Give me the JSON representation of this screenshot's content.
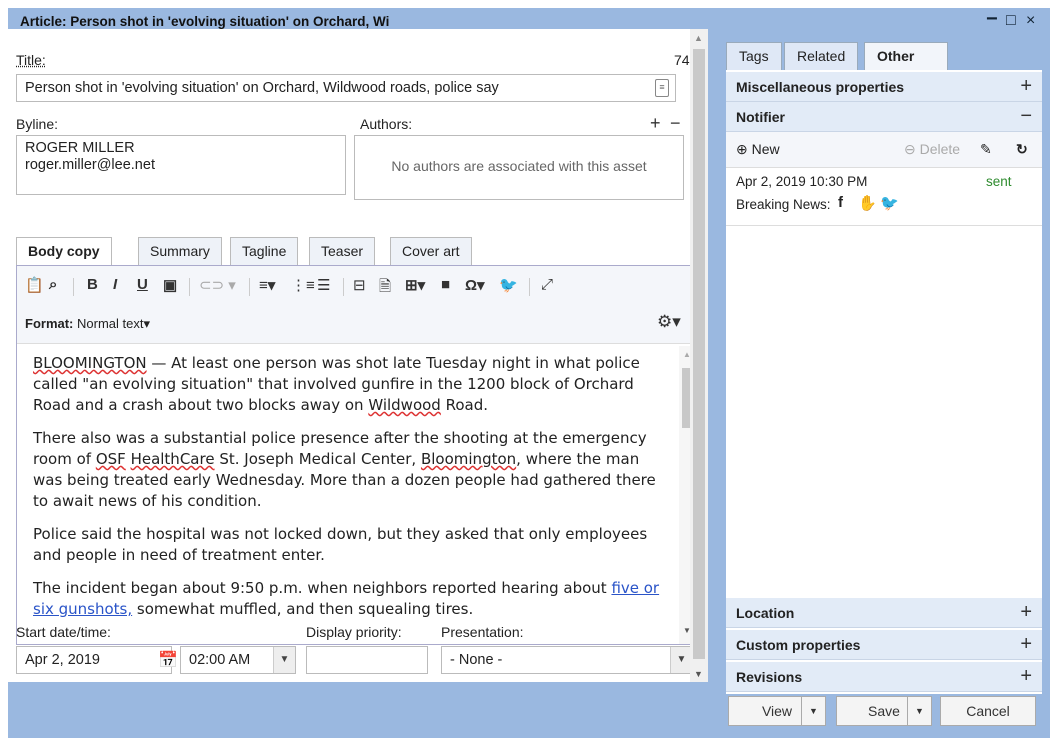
{
  "window": {
    "title": "Article: Person shot in 'evolving situation' on Orchard, Wi",
    "controls": [
      "−",
      "□",
      "×"
    ]
  },
  "title_field": {
    "label": "Title:",
    "count": "74",
    "value": "Person shot in 'evolving situation' on Orchard, Wildwood roads, police say"
  },
  "byline": {
    "label": "Byline:",
    "name": "ROGER MILLER",
    "email": "roger.miller@lee.net"
  },
  "authors": {
    "label": "Authors:",
    "empty_text": "No authors are associated with this asset",
    "add": "+",
    "remove": "−"
  },
  "content_tabs": [
    "Body copy",
    "Summary",
    "Tagline",
    "Teaser",
    "Cover art"
  ],
  "editor": {
    "format_label": "Format:",
    "format_value": "Normal text",
    "paragraphs": {
      "p1": {
        "w1": "BLOOMINGTON",
        "t1": " — At least one person was shot late Tuesday night in what police called \"an evolving situation\" that involved gunfire in the 1200 block of Orchard Road and a crash about two blocks away on ",
        "w2": "Wildwood",
        "t2": " Road."
      },
      "p2": {
        "t1": "There also was a substantial police presence after the shooting at the emergency room of ",
        "w1": "OSF",
        "t2": " ",
        "w2": "HealthCare",
        "t3": " St. Joseph Medical Center, ",
        "w3": "Bloomington",
        "t4": ", where the man was being treated early Wednesday. More than a dozen people had gathered there to await news of his condition."
      },
      "p3": "Police said the hospital was not locked down, but they asked that only employees and people in need of treatment enter.",
      "p4": {
        "t1": "The incident began about 9:50 p.m. when neighbors reported hearing about ",
        "link": "five or six gunshots,",
        "t2": " somewhat muffled, and then squealing tires."
      }
    }
  },
  "start_datetime": {
    "label": "Start date/time:",
    "date": "Apr 2, 2019",
    "time": "02:00 AM"
  },
  "display_priority": {
    "label": "Display priority:",
    "value": ""
  },
  "presentation": {
    "label": "Presentation:",
    "value": "- None -"
  },
  "right_tabs": [
    "Tags",
    "Related",
    "Other"
  ],
  "sections": {
    "misc": "Miscellaneous properties",
    "notifier": "Notifier",
    "location": "Location",
    "custom": "Custom properties",
    "revisions": "Revisions"
  },
  "notifier": {
    "new_label": "New",
    "delete_label": "Delete",
    "date": "Apr 2, 2019 10:30 PM",
    "status": "sent",
    "channel": "Breaking News:"
  },
  "buttons": {
    "view": "View",
    "save": "Save",
    "cancel": "Cancel"
  },
  "colors": {
    "frame": "#9ab8e0",
    "section": "#e2ebf7",
    "sent": "#2e8b2e",
    "link": "#2a54c8"
  }
}
